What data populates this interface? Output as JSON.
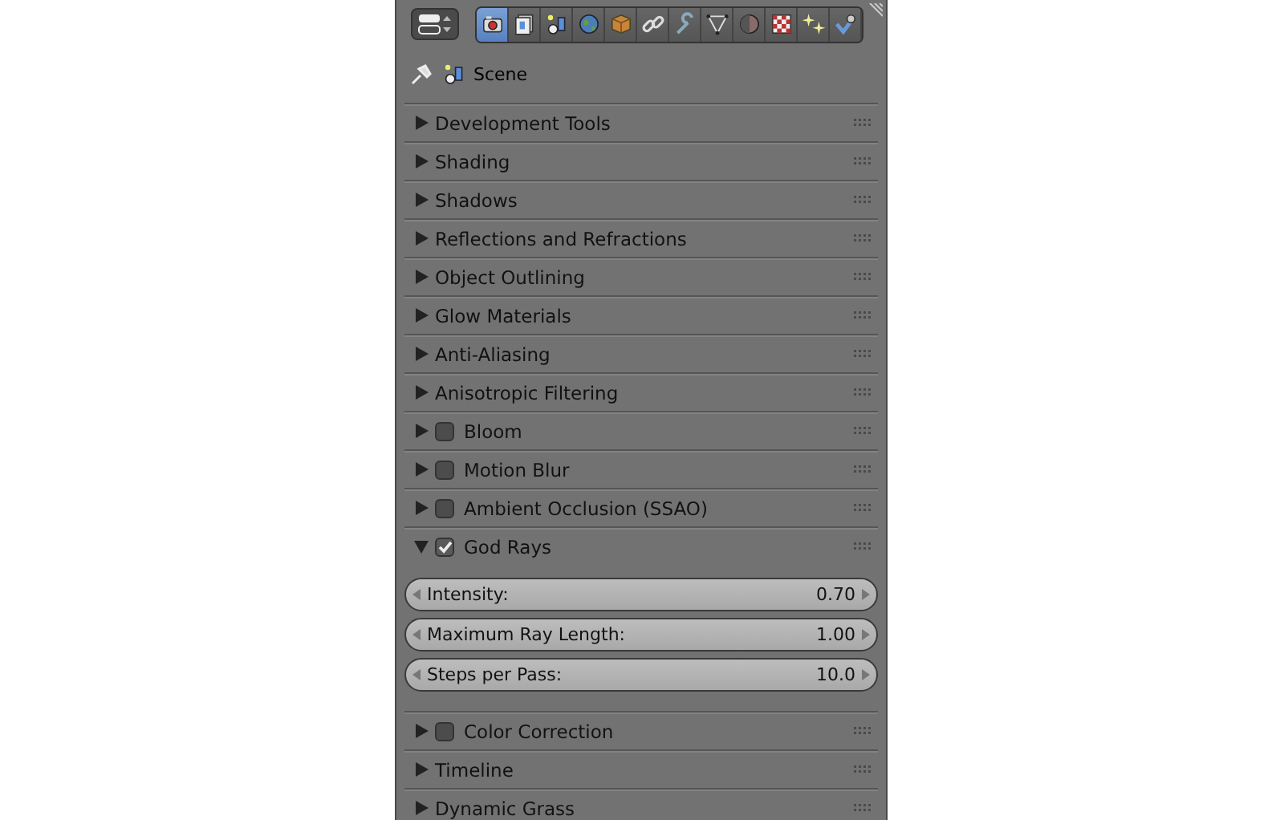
{
  "toolbar": {
    "tabs": [
      {
        "selected": true
      },
      {
        "selected": false
      },
      {
        "selected": false
      },
      {
        "selected": false
      },
      {
        "selected": false
      },
      {
        "selected": false
      },
      {
        "selected": false
      },
      {
        "selected": false
      },
      {
        "selected": false
      },
      {
        "selected": false
      },
      {
        "selected": false
      },
      {
        "selected": false
      }
    ]
  },
  "context": {
    "label": "Scene"
  },
  "panels": [
    {
      "kind": "plain",
      "label": "Development Tools",
      "expanded": false
    },
    {
      "kind": "plain",
      "label": "Shading",
      "expanded": false
    },
    {
      "kind": "plain",
      "label": "Shadows",
      "expanded": false
    },
    {
      "kind": "plain",
      "label": "Reflections and Refractions",
      "expanded": false
    },
    {
      "kind": "plain",
      "label": "Object Outlining",
      "expanded": false
    },
    {
      "kind": "plain",
      "label": "Glow Materials",
      "expanded": false
    },
    {
      "kind": "plain",
      "label": "Anti-Aliasing",
      "expanded": false
    },
    {
      "kind": "plain",
      "label": "Anisotropic Filtering",
      "expanded": false
    },
    {
      "kind": "toggle",
      "label": "Bloom",
      "expanded": false,
      "checked": false
    },
    {
      "kind": "toggle",
      "label": "Motion Blur",
      "expanded": false,
      "checked": false
    },
    {
      "kind": "toggle",
      "label": "Ambient Occlusion (SSAO)",
      "expanded": false,
      "checked": false
    },
    {
      "kind": "toggle",
      "label": "God Rays",
      "expanded": true,
      "checked": true,
      "fields": [
        {
          "label": "Intensity:",
          "value": "0.70"
        },
        {
          "label": "Maximum Ray Length:",
          "value": "1.00"
        },
        {
          "label": "Steps per Pass:",
          "value": "10.0"
        }
      ]
    },
    {
      "kind": "toggle",
      "label": "Color Correction",
      "expanded": false,
      "checked": false
    },
    {
      "kind": "plain",
      "label": "Timeline",
      "expanded": false
    },
    {
      "kind": "plain",
      "label": "Dynamic Grass",
      "expanded": false
    }
  ]
}
